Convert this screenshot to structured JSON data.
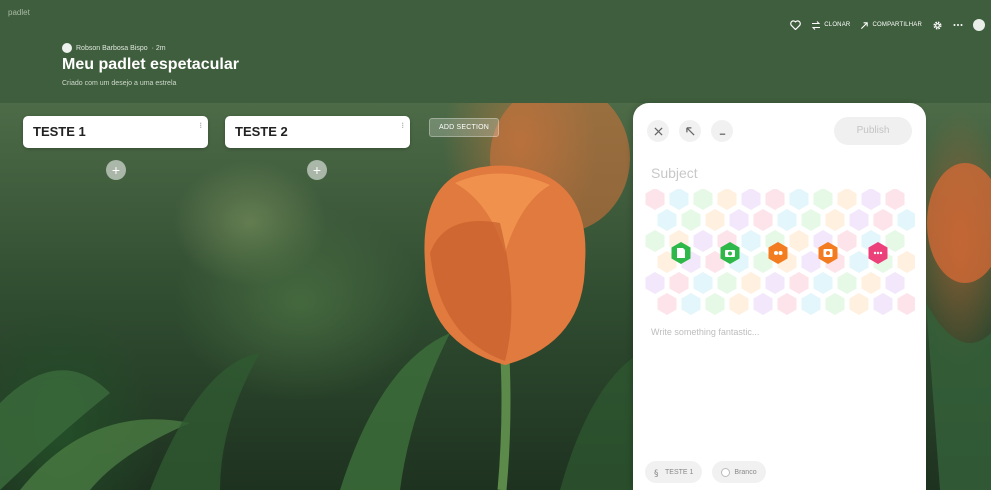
{
  "header": {
    "brand": "padlet",
    "author": "Robson Barbosa Bispo",
    "time_ago": "· 2m",
    "title": "Meu padlet espetacular",
    "subtitle": "Criado com um desejo a uma estrela",
    "actions": {
      "clone_label": "CLONAR",
      "share_label": "COMPARTILHAR"
    },
    "colors": {
      "header_bg": "#3f5e3d"
    }
  },
  "board": {
    "sections": [
      {
        "title": "TESTE 1"
      },
      {
        "title": "TESTE 2"
      }
    ],
    "add_section_label": "ADD SECTION",
    "add_post_symbol": "+"
  },
  "composer": {
    "publish_label": "Publish",
    "subject_placeholder": "Subject",
    "body_placeholder": "Write something fantastic...",
    "attachments": [
      {
        "name": "file-upload-icon",
        "color": "#2fb84a"
      },
      {
        "name": "camera-icon",
        "color": "#2fb84a"
      },
      {
        "name": "video-icon",
        "color": "#f47c20"
      },
      {
        "name": "image-search-icon",
        "color": "#f47c20"
      },
      {
        "name": "more-options-icon",
        "color": "#ec407a"
      }
    ],
    "chips": [
      {
        "label": "TESTE 1"
      },
      {
        "label": "Branco"
      }
    ]
  }
}
